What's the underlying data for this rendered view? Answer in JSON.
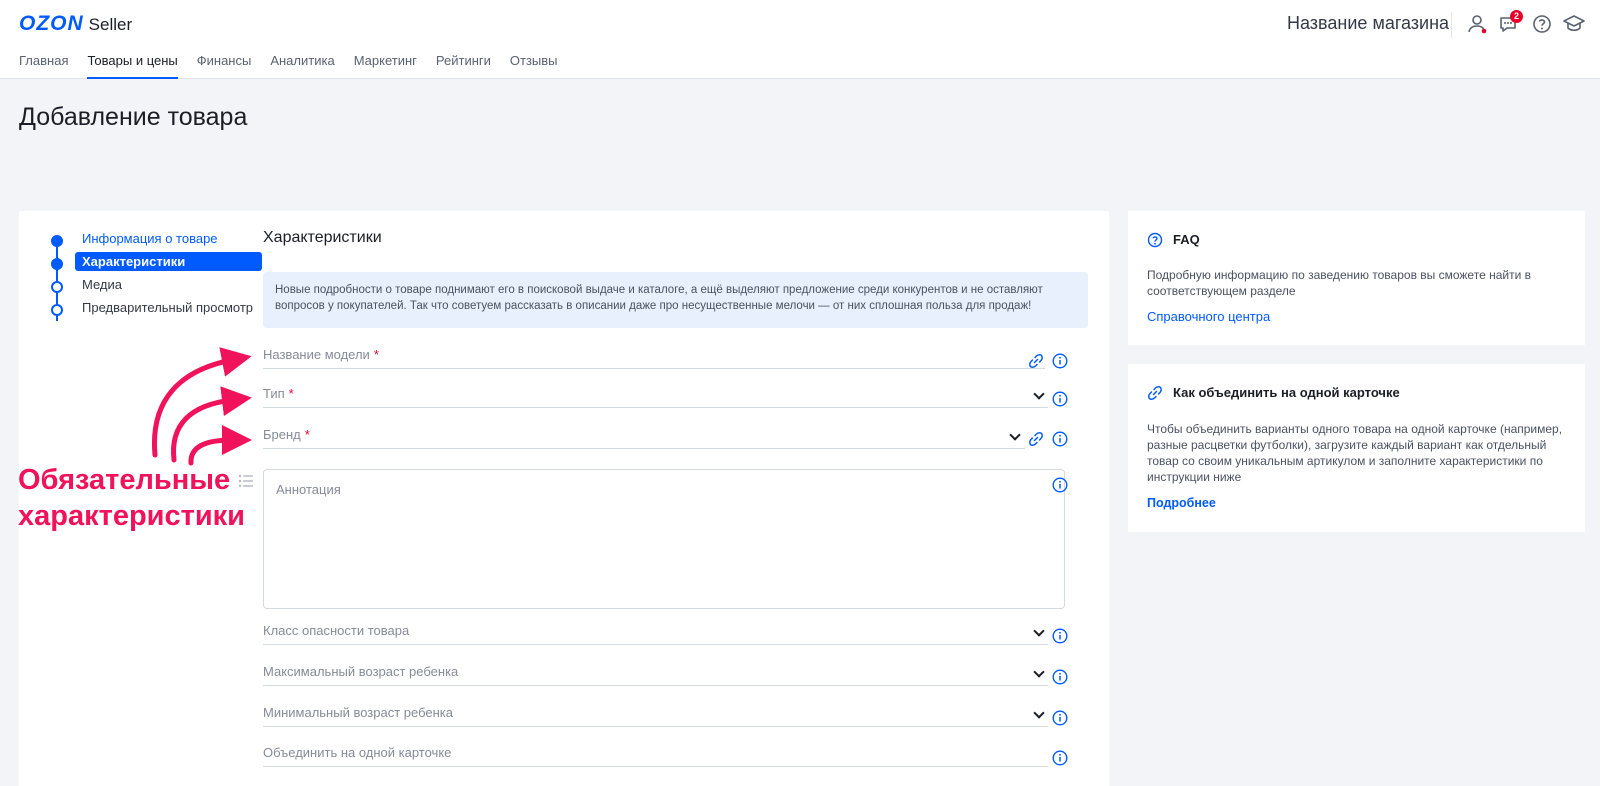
{
  "header": {
    "logo_brand": "OZON",
    "logo_product": "Seller",
    "store_name": "Название магазина",
    "notifications_count": "2",
    "icons": [
      "user-icon",
      "chat-icon",
      "help-icon",
      "education-icon"
    ]
  },
  "nav": {
    "items": [
      "Главная",
      "Товары и цены",
      "Финансы",
      "Аналитика",
      "Маркетинг",
      "Рейтинги",
      "Отзывы"
    ],
    "active_index": 1
  },
  "page_title": "Добавление товара",
  "steps": {
    "items": [
      "Информация о товаре",
      "Характеристики",
      "Медиа",
      "Предварительный просмотр"
    ],
    "current_index": 1
  },
  "section": {
    "title": "Характеристики",
    "info_text": "Новые подробности о товаре поднимают его в поисковой выдаче и каталоге, а ещё выделяют предложение среди конкурентов и не оставляют вопросов у покупателей. Так что советуем рассказать в описании даже про несущественные мелочи — от них сплошная польза для продаж!"
  },
  "fields": {
    "model_name": "Название модели",
    "type": "Тип",
    "brand": "Бренд",
    "annotation_placeholder": "Аннотация",
    "hazard_class": "Класс опасности товара",
    "max_age": "Максимальный возраст ребенка",
    "min_age": "Минимальный возраст ребенка",
    "merge_card": "Объединить на одной карточке",
    "required_mark": "*"
  },
  "faq": {
    "title": "FAQ",
    "text": "Подробную информацию по заведению товаров вы сможете найти в соответствующем разделе",
    "link": "Справочного центра"
  },
  "merge_help": {
    "title": "Как объединить на одной карточке",
    "text": "Чтобы объединить варианты одного товара на одной карточке (например, разные расцветки футболки), загрузите каждый вариант как отдельный товар со своим уникальным артикулом и заполните характеристики по инструкции ниже",
    "link": "Подробнее"
  },
  "annotation": {
    "line1": "Обязательные",
    "line2": "характеристики",
    "color": "#f0125a"
  },
  "colors": {
    "accent": "#005bff",
    "required": "#e8002d"
  }
}
